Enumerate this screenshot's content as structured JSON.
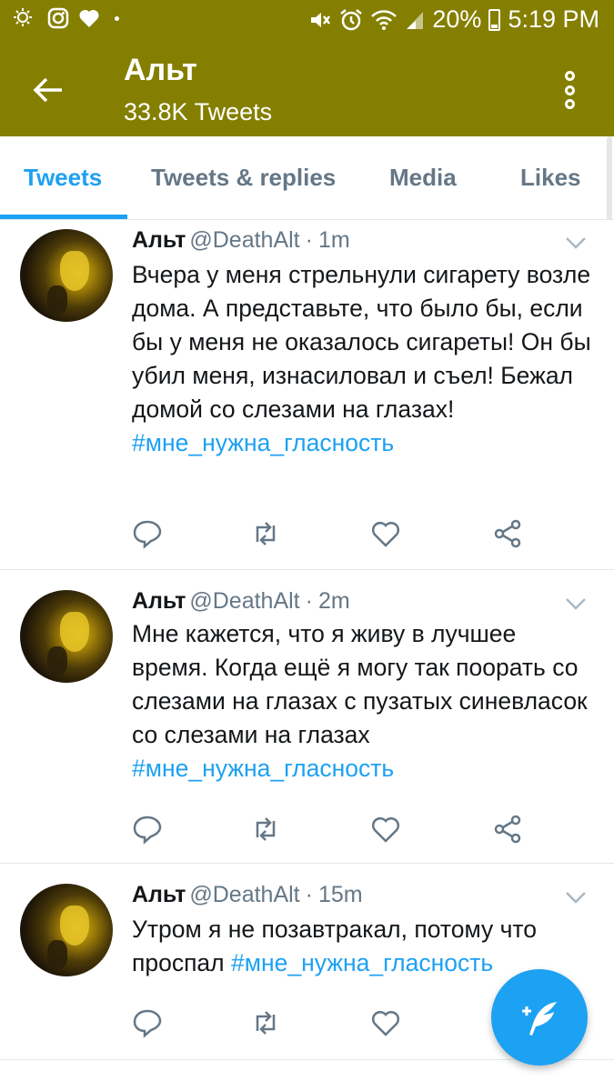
{
  "status_bar": {
    "battery": "20%",
    "time": "5:19 PM",
    "left_icons": [
      "weather-icon",
      "instagram-icon",
      "heart-icon"
    ],
    "right_icons": [
      "mute-icon",
      "alarm-icon",
      "wifi-icon",
      "signal-icon",
      "battery-icon"
    ]
  },
  "header": {
    "title": "Альт",
    "subtitle": "33.8K Tweets",
    "background": "#847f00"
  },
  "tabs": [
    {
      "label": "Tweets",
      "active": true
    },
    {
      "label": "Tweets & replies",
      "active": false
    },
    {
      "label": "Media",
      "active": false
    },
    {
      "label": "Likes",
      "active": false
    }
  ],
  "tweets": [
    {
      "name": "Альт",
      "handle": "@DeathAlt",
      "separator": "·",
      "time": "1m",
      "text": "Вчера у меня стрельнули сигарету возле дома. А представьте, что было бы, если бы у меня не оказалось сигареты! Он бы убил меня, изнасиловал и съел! Бежал домой со слезами на глазах!",
      "hashtag": "#мне_нужна_гласность"
    },
    {
      "name": "Альт",
      "handle": "@DeathAlt",
      "separator": "·",
      "time": "2m",
      "text": "Мне кажется, что я живу в лучшее время. Когда ещё я могу так поорать со слезами на глазах с пузатых синевласок со слезами на глазах",
      "hashtag": "#мне_нужна_гласность"
    },
    {
      "name": "Альт",
      "handle": "@DeathAlt",
      "separator": "·",
      "time": "15m",
      "text": "Утром я не позавтракал, потому что проспал",
      "hashtag": "#мне_нужна_гласность"
    }
  ],
  "colors": {
    "accent": "#1da1f2",
    "secondary_text": "#657786",
    "action_icons": "#657786"
  }
}
